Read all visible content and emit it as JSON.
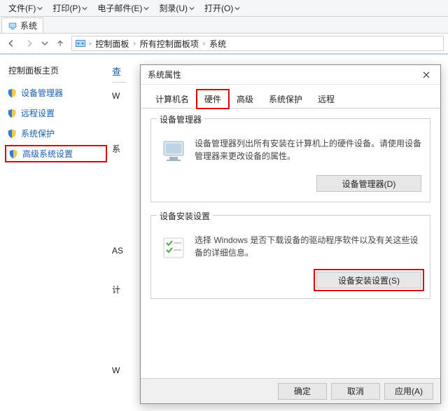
{
  "menu": {
    "file": "文件(F)",
    "print": "打印(P)",
    "email": "电子邮件(E)",
    "burn": "刻录(U)",
    "open": "打开(O)"
  },
  "window_tab": "系统",
  "breadcrumb": {
    "root": "控制面板",
    "mid": "所有控制面板项",
    "leaf": "系统"
  },
  "sidebar": {
    "home": "控制面板主页",
    "items": [
      "设备管理器",
      "远程设置",
      "系统保护",
      "高级系统设置"
    ]
  },
  "content": {
    "heading": "查",
    "stubs": [
      "W",
      "系",
      "AS",
      "计",
      "W"
    ]
  },
  "dialog": {
    "title": "系统属性",
    "tabs": [
      "计算机名",
      "硬件",
      "高级",
      "系统保护",
      "远程"
    ],
    "active_tab_index": 1,
    "group1": {
      "legend": "设备管理器",
      "text": "设备管理器列出所有安装在计算机上的硬件设备。请使用设备管理器来更改设备的属性。",
      "button": "设备管理器(D)"
    },
    "group2": {
      "legend": "设备安装设置",
      "text": "选择 Windows 是否下载设备的驱动程序软件以及有关这些设备的详细信息。",
      "button": "设备安装设置(S)"
    },
    "footer": {
      "ok": "确定",
      "cancel": "取消",
      "apply": "应用(A)"
    }
  }
}
